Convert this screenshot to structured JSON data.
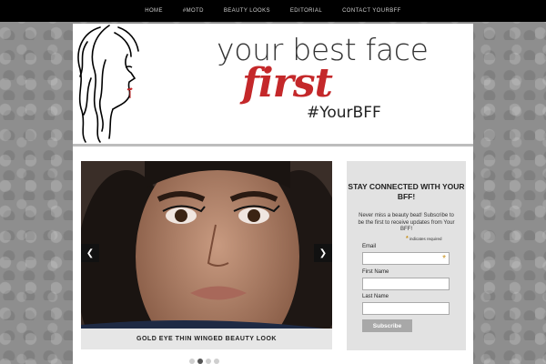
{
  "nav": {
    "items": [
      "HOME",
      "#MOTD",
      "BEAUTY LOOKS",
      "EDITORIAL",
      "CONTACT YOURBFF"
    ]
  },
  "header": {
    "line1": "your best face",
    "line2": "first",
    "line3": "#YourBFF",
    "logo_icon": "woman-face-sketch-icon"
  },
  "slider": {
    "caption": "GOLD EYE THIN WINGED BEAUTY LOOK",
    "prev_icon": "chevron-left-icon",
    "next_icon": "chevron-right-icon",
    "dots": 4,
    "active_dot": 1
  },
  "sidebar": {
    "title": "STAY CONNECTED WITH YOUR BFF!",
    "text": "Never miss a beauty beat! Subscribe to be the first to receive updates from Your BFF!",
    "required_note": "indicates required",
    "fields": [
      {
        "label": "Email",
        "value": ""
      },
      {
        "label": "First Name",
        "value": ""
      },
      {
        "label": "Last Name",
        "value": ""
      }
    ],
    "button": "Subscribe"
  },
  "colors": {
    "accent_red": "#c4282a",
    "required_star": "#c8901a",
    "nav_bg": "#000000"
  }
}
